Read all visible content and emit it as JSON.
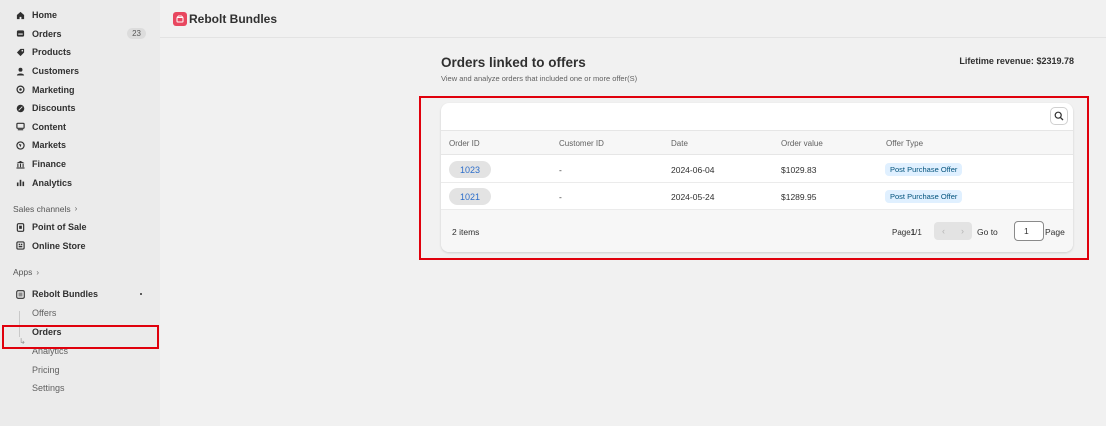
{
  "sidebar": {
    "items": [
      {
        "label": "Home",
        "icon": "home-icon"
      },
      {
        "label": "Orders",
        "icon": "orders-icon",
        "badge": "23"
      },
      {
        "label": "Products",
        "icon": "tag-icon"
      },
      {
        "label": "Customers",
        "icon": "person-icon"
      },
      {
        "label": "Marketing",
        "icon": "target-icon"
      },
      {
        "label": "Discounts",
        "icon": "discount-icon"
      },
      {
        "label": "Content",
        "icon": "content-icon"
      },
      {
        "label": "Markets",
        "icon": "globe-icon"
      },
      {
        "label": "Finance",
        "icon": "bank-icon"
      },
      {
        "label": "Analytics",
        "icon": "bar-chart-icon"
      }
    ],
    "sales_channels_label": "Sales channels",
    "channels": [
      {
        "label": "Point of Sale",
        "icon": "pos-icon"
      },
      {
        "label": "Online Store",
        "icon": "store-icon"
      }
    ],
    "apps_label": "Apps",
    "app": {
      "label": "Rebolt Bundles",
      "icon": "app-icon"
    },
    "app_subitems": [
      "Offers",
      "Orders",
      "Analytics",
      "Pricing",
      "Settings"
    ],
    "active_subitem": "Orders"
  },
  "topbar": {
    "app_title": "Rebolt Bundles",
    "logo_color": "#e8475f"
  },
  "main": {
    "title": "Orders linked to offers",
    "subtitle": "View and analyze orders that included one or more offer(S)",
    "revenue_label": "Lifetime revenue:",
    "revenue_value": "$2319.78"
  },
  "table": {
    "columns": [
      "Order ID",
      "Customer ID",
      "Date",
      "Order value",
      "Offer Type"
    ],
    "rows": [
      {
        "order_id": "1023",
        "customer_id": "-",
        "date": "2024-06-04",
        "order_value": "$1029.83",
        "offer_type": "Post Purchase Offer"
      },
      {
        "order_id": "1021",
        "customer_id": "-",
        "date": "2024-05-24",
        "order_value": "$1289.95",
        "offer_type": "Post Purchase Offer"
      }
    ],
    "items_count": "2 items",
    "page_label": "Page",
    "page_current": "1",
    "page_sep": "/",
    "page_total": "1",
    "goto_label": "Go to",
    "goto_value": "1",
    "page_suffix": "Page"
  },
  "colors": {
    "highlight": "#e0000c",
    "link": "#2c6ecb",
    "tag_bg": "#e0f0ff"
  }
}
